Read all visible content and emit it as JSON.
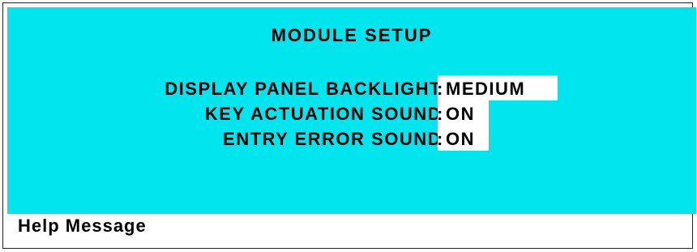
{
  "screen": {
    "title": "MODULE SETUP",
    "background_color": "#00e5ee",
    "settings": [
      {
        "label": "DISPLAY PANEL BACKLIGHT",
        "separator": ":",
        "value": "MEDIUM"
      },
      {
        "label": "KEY ACTUATION SOUND",
        "separator": ":",
        "value": "ON"
      },
      {
        "label": "ENTRY ERROR SOUND",
        "separator": ":",
        "value": "ON"
      }
    ]
  },
  "footer": {
    "help_label": "Help Message"
  }
}
